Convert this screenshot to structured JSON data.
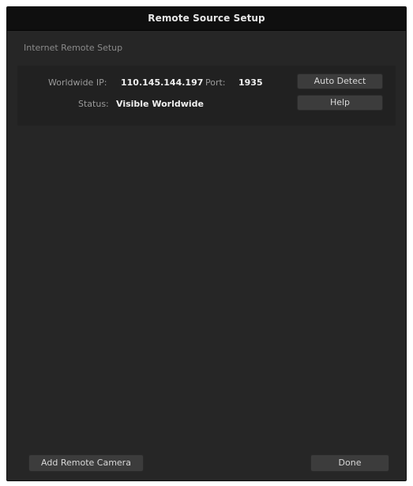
{
  "dialog": {
    "title": "Remote Source Setup"
  },
  "internet_remote": {
    "section_label": "Internet Remote Setup",
    "worldwide_ip_label": "Worldwide IP:",
    "worldwide_ip_value": "110.145.144.197",
    "port_label": "Port:",
    "port_value": "1935",
    "status_label": "Status:",
    "status_value": "Visible Worldwide",
    "auto_detect_label": "Auto Detect",
    "help_label": "Help"
  },
  "footer": {
    "add_remote_camera_label": "Add Remote Camera",
    "done_label": "Done"
  }
}
